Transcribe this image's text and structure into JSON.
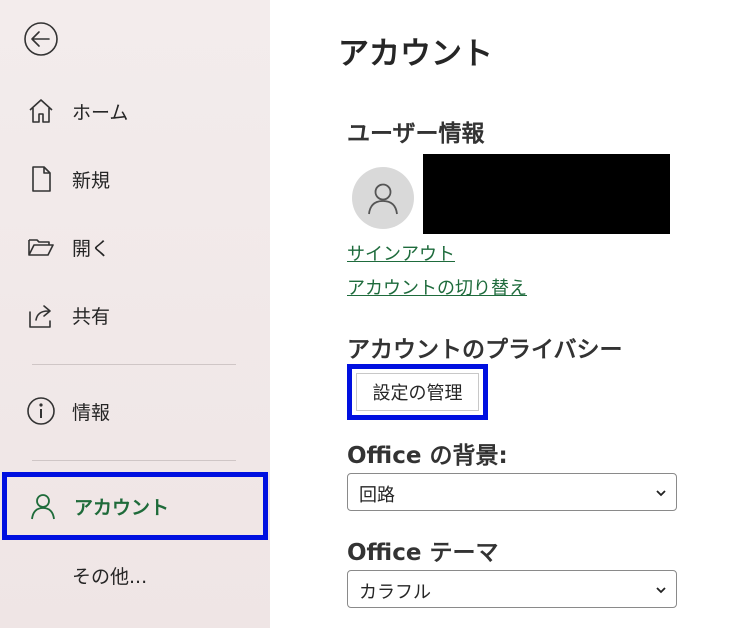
{
  "sidebar": {
    "items": [
      {
        "label": "ホーム",
        "icon": "home-icon"
      },
      {
        "label": "新規",
        "icon": "new-document-icon"
      },
      {
        "label": "開く",
        "icon": "open-folder-icon"
      },
      {
        "label": "共有",
        "icon": "share-icon"
      },
      {
        "label": "情報",
        "icon": "info-icon"
      },
      {
        "label": "アカウント",
        "icon": "account-person-icon",
        "active": true
      },
      {
        "label": "その他..."
      }
    ],
    "accent_color": "#1f6b3a",
    "highlight_color": "#0010e0"
  },
  "main": {
    "title": "アカウント",
    "user_info": {
      "heading": "ユーザー情報",
      "sign_out": "サインアウト",
      "switch_account": "アカウントの切り替え"
    },
    "privacy": {
      "heading": "アカウントのプライバシー",
      "manage_button": "設定の管理"
    },
    "background": {
      "heading": "Office の背景:",
      "value": "回路"
    },
    "theme": {
      "heading": "Office テーマ",
      "value": "カラフル"
    }
  }
}
